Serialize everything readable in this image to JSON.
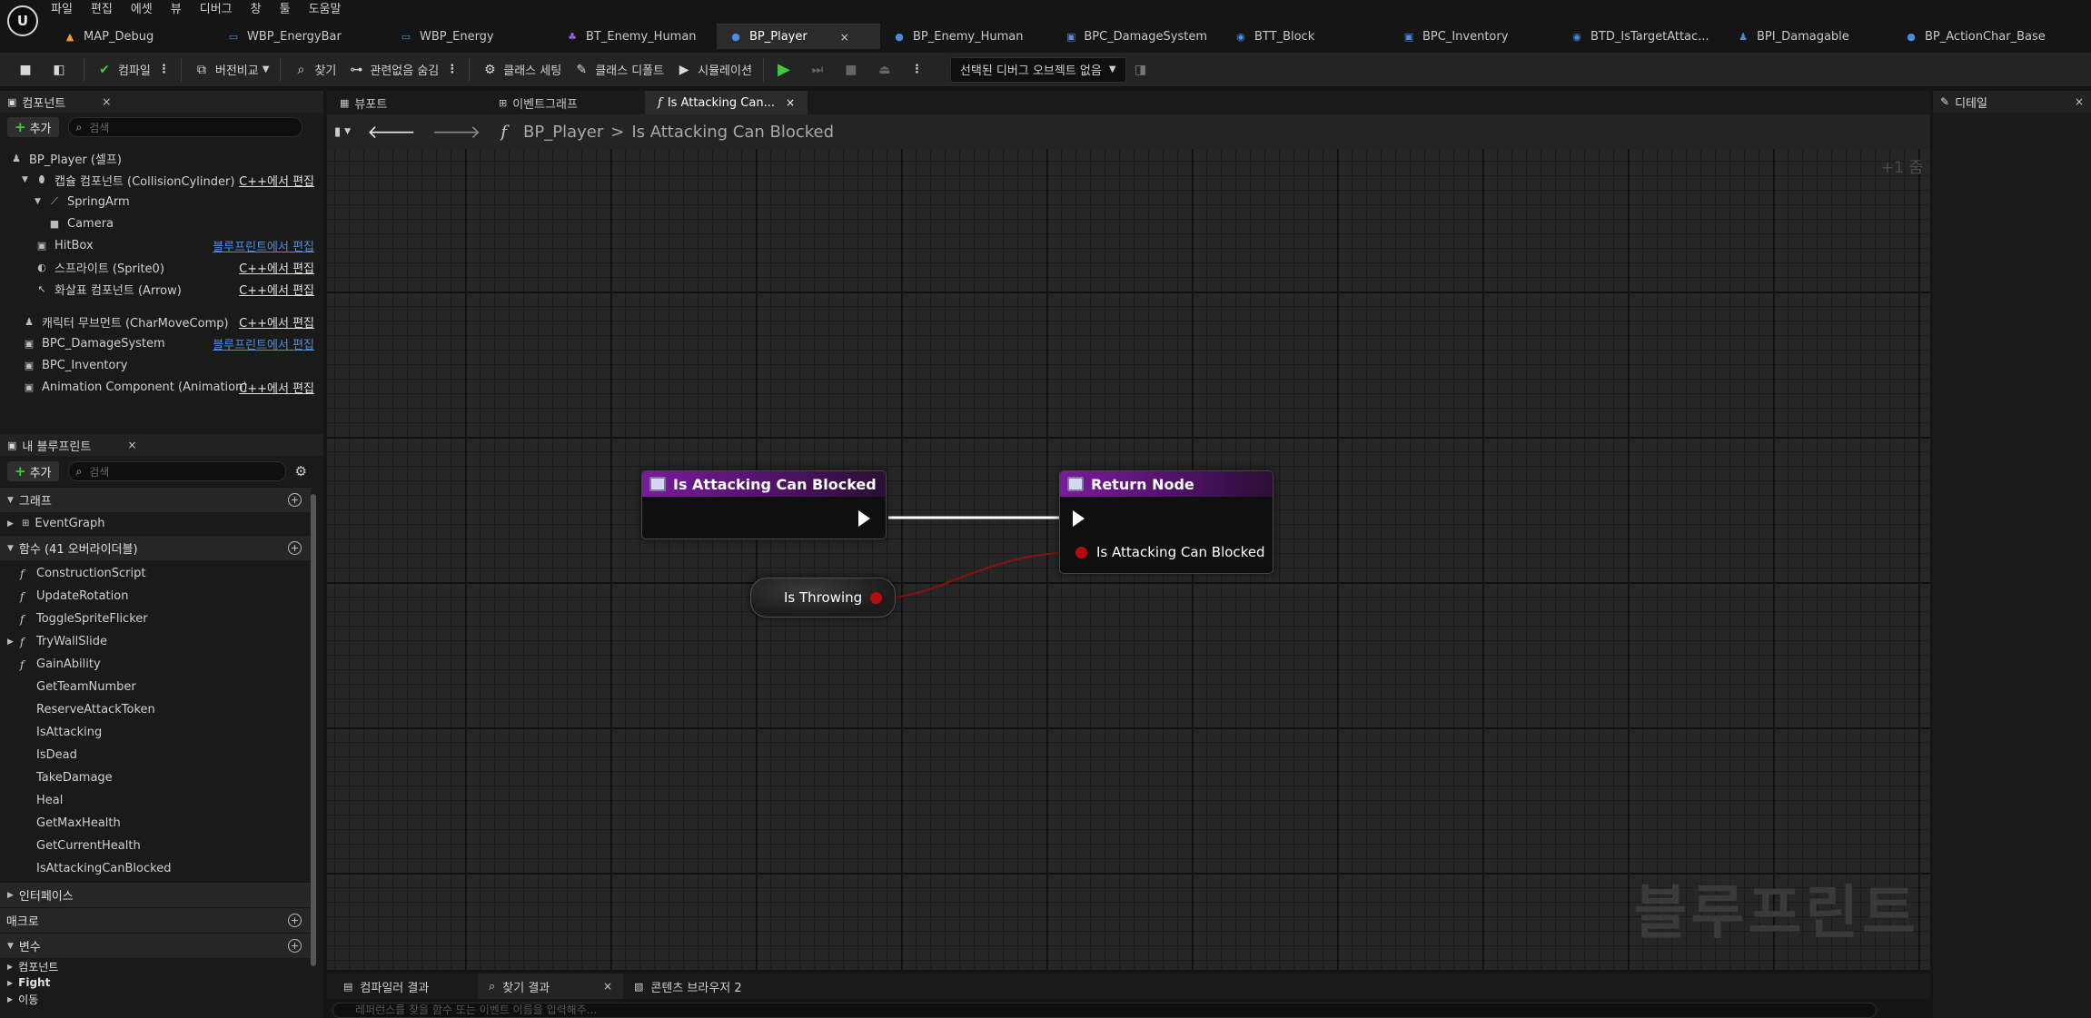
{
  "menu": {
    "logo": "U",
    "items": [
      "파일",
      "편집",
      "에셋",
      "뷰",
      "디버그",
      "창",
      "툴",
      "도움말"
    ]
  },
  "doc_tabs": [
    {
      "label": "MAP_Debug",
      "icon": "map-icon",
      "color": "#e8a23a"
    },
    {
      "label": "WBP_EnergyBar",
      "icon": "widget-icon",
      "color": "#4a8de0"
    },
    {
      "label": "WBP_Energy",
      "icon": "widget-icon",
      "color": "#4a8de0"
    },
    {
      "label": "BT_Enemy_Human",
      "icon": "tree-icon",
      "color": "#9a5fd8"
    },
    {
      "label": "BP_Player",
      "icon": "character-icon",
      "color": "#4a8de0",
      "active": true,
      "close": "×"
    },
    {
      "label": "BP_Enemy_Human",
      "icon": "character-icon",
      "color": "#4a8de0"
    },
    {
      "label": "BPC_DamageSystem",
      "icon": "component-icon",
      "color": "#4a8de0"
    },
    {
      "label": "BTT_Block",
      "icon": "task-icon",
      "color": "#4a8de0"
    },
    {
      "label": "BPC_Inventory",
      "icon": "component-icon",
      "color": "#4a8de0"
    },
    {
      "label": "BTD_IsTargetAttac...",
      "icon": "decorator-icon",
      "color": "#4a8de0"
    },
    {
      "label": "BPI_Damagable",
      "icon": "interface-icon",
      "color": "#4a8de0"
    },
    {
      "label": "BP_ActionChar_Base",
      "icon": "character-icon",
      "color": "#4a8de0"
    }
  ],
  "toolbar": {
    "compile": "컴파일",
    "diff": "버전비교",
    "find": "찾기",
    "hide_unrelated": "관련없음 숨김",
    "class_settings": "클래스 세팅",
    "class_defaults": "클래스 디폴트",
    "simulation": "시뮬레이션",
    "debug_object": "선택된 디버그 오브젝트 없음"
  },
  "components_panel": {
    "title": "컴포넌트",
    "close": "×",
    "add": "추가",
    "search_placeholder": "검색",
    "rows": [
      {
        "label": "BP_Player (셀프)",
        "icon": "person-icon",
        "indent": 0,
        "edit": ""
      },
      {
        "label": "캡슐 컴포넌트 (CollisionCylinder)",
        "icon": "capsule-icon",
        "indent": 1,
        "arrow": "▼",
        "edit": "C++에서 편집",
        "bp": false
      },
      {
        "label": "SpringArm",
        "icon": "springarm-icon",
        "indent": 2,
        "arrow": "▼",
        "edit": ""
      },
      {
        "label": "Camera",
        "icon": "camera-icon",
        "indent": 3,
        "edit": ""
      },
      {
        "label": "HitBox",
        "icon": "box-icon",
        "indent": 2,
        "edit": "블루프린트에서 편집",
        "bp": true
      },
      {
        "label": "스프라이트 (Sprite0)",
        "icon": "sprite-icon",
        "indent": 2,
        "edit": "C++에서 편집",
        "bp": false
      },
      {
        "label": "화살표 컴포넌트 (Arrow)",
        "icon": "arrow-icon",
        "indent": 2,
        "edit": "C++에서 편집",
        "bp": false
      },
      {
        "label": "캐릭터 무브먼트 (CharMoveComp)",
        "icon": "movement-icon",
        "indent": 1,
        "edit": "C++에서 편집",
        "bp": false,
        "gap": true
      },
      {
        "label": "BPC_DamageSystem",
        "icon": "component-icon",
        "indent": 1,
        "edit": "블루프린트에서 편집",
        "bp": true
      },
      {
        "label": "BPC_Inventory",
        "icon": "component-icon",
        "indent": 1,
        "edit": ""
      },
      {
        "label": "Animation Component (Animation)",
        "icon": "component-icon",
        "indent": 1,
        "edit": "C++에서 편집",
        "bp": false
      }
    ]
  },
  "myblueprint_panel": {
    "title": "내 블루프린트",
    "close": "×",
    "add": "추가",
    "search_placeholder": "검색",
    "graph_section": "그래프",
    "event_graph": "EventGraph",
    "functions_section": "함수 (41 오버라이더블)",
    "functions": [
      "ConstructionScript",
      "UpdateRotation",
      "ToggleSpriteFlicker",
      "TryWallSlide",
      "GainAbility",
      "GetTeamNumber",
      "ReserveAttackToken",
      "IsAttacking",
      "IsDead",
      "TakeDamage",
      "Heal",
      "GetMaxHealth",
      "GetCurrentHealth",
      "IsAttackingCanBlocked"
    ],
    "interface_section": "인터페이스",
    "macro_section": "매크로",
    "variables_section": "변수",
    "variable_groups": [
      "컴포넌트",
      "Fight",
      "이동"
    ]
  },
  "graph": {
    "tabs": [
      {
        "label": "뷰포트",
        "icon": "viewport-icon"
      },
      {
        "label": "이벤트그래프",
        "icon": "graph-icon"
      },
      {
        "label": "Is Attacking Can...",
        "icon": "function-icon",
        "active": true,
        "close": "×"
      }
    ],
    "breadcrumb_root": "BP_Player",
    "breadcrumb_sep": ">",
    "breadcrumb_current": "Is Attacking Can Blocked",
    "zoom": "+1 줌",
    "watermark": "블루프린트",
    "entry_node": {
      "title": "Is Attacking Can Blocked"
    },
    "return_node": {
      "title": "Return Node",
      "pin": "Is Attacking Can Blocked"
    },
    "var_node": {
      "label": "Is Throwing"
    },
    "colors": {
      "exec_wire": "#ffffff",
      "bool_wire": "#8a0f0f",
      "bool_pin": "#b40d0d",
      "node_header": "#7b1aa0"
    }
  },
  "details_panel": {
    "title": "디테일",
    "close": "×"
  },
  "bottom": {
    "tabs": [
      {
        "label": "컴파일러 결과",
        "icon": "compiler-icon"
      },
      {
        "label": "찾기 결과",
        "icon": "search-icon",
        "close": "×"
      },
      {
        "label": "콘텐츠 브라우저 2",
        "icon": "folder-icon"
      }
    ],
    "search_placeholder": "레퍼런스를 찾을 함수 또는 이벤트 이름을 입력해주..."
  }
}
